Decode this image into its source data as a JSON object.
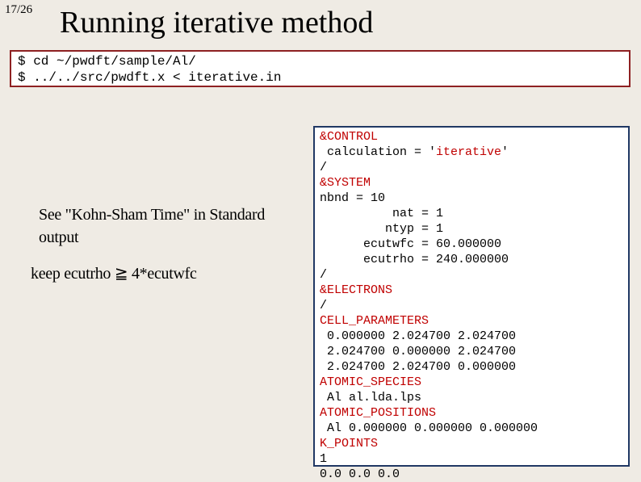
{
  "page_number": "17/26",
  "title": "Running iterative method",
  "cmd_line1": "$ cd ~/pwdft/sample/Al/",
  "cmd_line2": "$ ../../src/pwdft.x < iterative.in",
  "note1": "See \"Kohn-Sham Time\" in Standard output",
  "note2": "keep ecutrho ≧ 4*ecutwfc",
  "input": {
    "l01a": "&CONTROL",
    "l02a": " calculation = '",
    "l02b": "iterative",
    "l02c": "'",
    "l03a": "/",
    "l04a": "&SYSTEM",
    "l05a": "nbnd = 10",
    "l06a": "          nat = 1",
    "l07a": "         ntyp = 1",
    "l08a": "      ecutwfc = 60.000000",
    "l09a": "      ecutrho = 240.000000",
    "l10a": "/",
    "l11a": "&ELECTRONS",
    "l12a": "/",
    "l13a": "CELL_PARAMETERS",
    "l14a": " 0.000000 2.024700 2.024700",
    "l15a": " 2.024700 0.000000 2.024700",
    "l16a": " 2.024700 2.024700 0.000000",
    "l17a": "ATOMIC_SPECIES",
    "l18a": " Al al.lda.lps",
    "l19a": "ATOMIC_POSITIONS",
    "l20a": " Al 0.000000 0.000000 0.000000",
    "l21a": "K_POINTS",
    "l22a": "1",
    "l23a": "0.0 0.0 0.0"
  }
}
